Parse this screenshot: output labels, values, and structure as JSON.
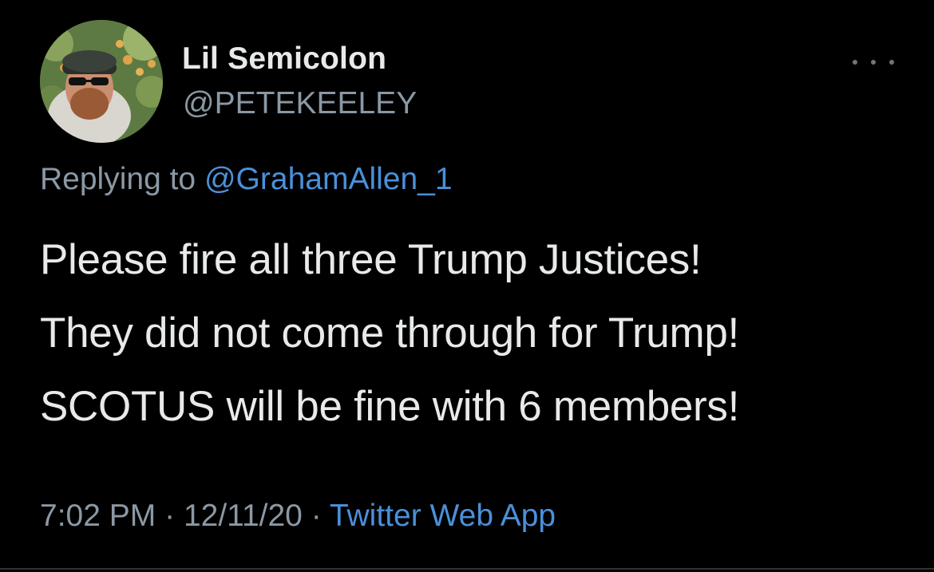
{
  "tweet": {
    "author": {
      "display_name": "Lil Semicolon",
      "handle": "@PETEKEELEY",
      "avatar_icon": "profile-photo"
    },
    "more_icon": "more-horizontal-icon",
    "replying_to": {
      "prefix": "Replying to",
      "mention": "@GrahamAllen_1"
    },
    "text_lines": [
      "Please fire all three Trump Justices!",
      "They did not come through for Trump!",
      "SCOTUS will be fine with 6 members!"
    ],
    "meta": {
      "time": "7:02 PM",
      "separator": "·",
      "date": "12/11/20",
      "source": "Twitter Web App"
    }
  },
  "colors": {
    "background": "#000000",
    "primary_text": "#e7e9ea",
    "secondary_text": "#8b98a5",
    "link": "#4a90d9"
  }
}
